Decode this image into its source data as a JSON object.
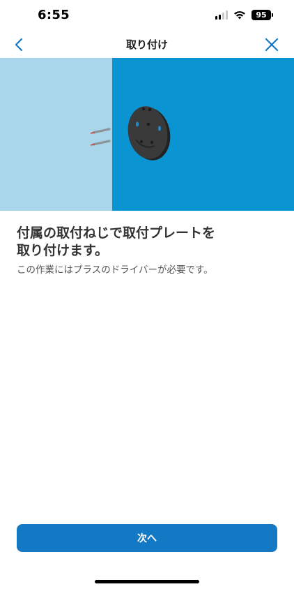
{
  "status_bar": {
    "time": "6:55",
    "battery": "95"
  },
  "nav": {
    "title": "取り付け",
    "back_icon": "chevron-left-icon",
    "close_icon": "close-icon"
  },
  "illustration": {
    "wall_color": "#a9d6ea",
    "background_color": "#0b94d2",
    "plate_color": "#3a3a3a",
    "accent_color": "#1e8fd6"
  },
  "content": {
    "heading": "付属の取付ねじで取付プレートを取り付けます。",
    "heading_line1": "付属の取付ねじで取付プレートを",
    "heading_line2": "取り付けます。",
    "description": "この作業にはプラスのドライバーが必要です。"
  },
  "footer": {
    "next_label": "次へ",
    "button_color": "#1479c4"
  },
  "colors": {
    "accent": "#1479c4"
  }
}
